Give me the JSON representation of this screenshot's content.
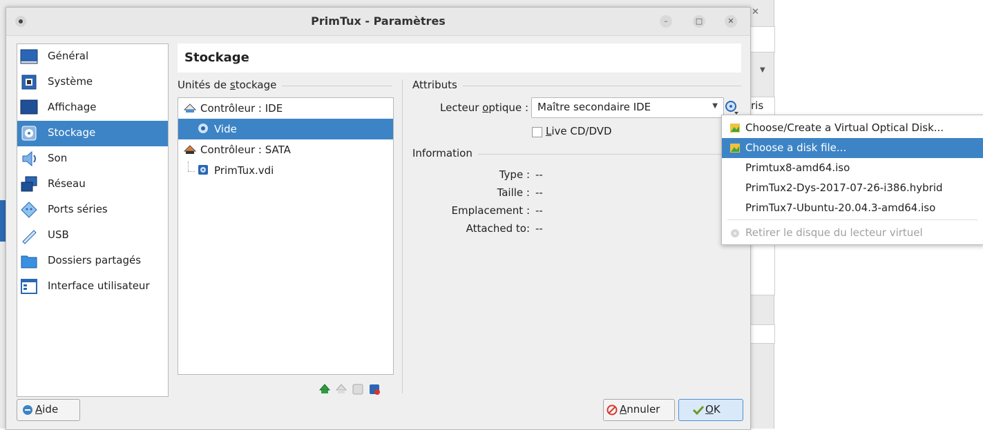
{
  "window": {
    "title": "PrimTux - Paramètres"
  },
  "sidebar": {
    "items": [
      {
        "label": "Général",
        "icon": "general-icon"
      },
      {
        "label": "Système",
        "icon": "system-icon"
      },
      {
        "label": "Affichage",
        "icon": "display-icon"
      },
      {
        "label": "Stockage",
        "icon": "storage-icon",
        "selected": true
      },
      {
        "label": "Son",
        "icon": "audio-icon"
      },
      {
        "label": "Réseau",
        "icon": "network-icon"
      },
      {
        "label": "Ports séries",
        "icon": "serial-ports-icon"
      },
      {
        "label": "USB",
        "icon": "usb-icon"
      },
      {
        "label": "Dossiers partagés",
        "icon": "shared-folders-icon"
      },
      {
        "label": "Interface utilisateur",
        "icon": "user-interface-icon"
      }
    ]
  },
  "page": {
    "title": "Stockage"
  },
  "storage": {
    "group_label_pre": "Unités de ",
    "group_label_mnemonic": "s",
    "group_label_post": "tockage",
    "tree": [
      {
        "label": "Contrôleur : IDE",
        "level": 0,
        "icon": "ide-controller-icon"
      },
      {
        "label": "Vide",
        "level": 1,
        "icon": "optical-disc-icon",
        "selected": true
      },
      {
        "label": "Contrôleur : SATA",
        "level": 0,
        "icon": "sata-controller-icon"
      },
      {
        "label": "PrimTux.vdi",
        "level": 1,
        "icon": "hard-disk-icon"
      }
    ]
  },
  "attributes": {
    "group_label": "Attributs",
    "optical_drive_label_pre": "Lecteur ",
    "optical_drive_label_mnemonic": "o",
    "optical_drive_label_post": "ptique :",
    "optical_drive_value": "Maître secondaire IDE",
    "live_cd_mnemonic": "L",
    "live_cd_label": "ive CD/DVD",
    "live_cd_checked": false
  },
  "information": {
    "group_label": "Information",
    "rows": [
      {
        "label": "Type :",
        "value": "--"
      },
      {
        "label": "Taille :",
        "value": "--"
      },
      {
        "label": "Emplacement :",
        "value": "--"
      },
      {
        "label": "Attached to:",
        "value": "--"
      }
    ]
  },
  "buttons": {
    "help_mnemonic": "A",
    "help_label": "ide",
    "cancel_mnemonic": "A",
    "cancel_label": "nnuler",
    "ok_mnemonic": "O",
    "ok_label": "K"
  },
  "background_fragment": "ris",
  "popup_menu": {
    "items": [
      {
        "label": "Choose/Create a Virtual Optical Disk...",
        "icon": "optical-disk-create-icon"
      },
      {
        "label": "Choose a disk file...",
        "icon": "disk-file-icon",
        "highlighted": true
      },
      {
        "label": "Primtux8-amd64.iso"
      },
      {
        "label": "PrimTux2-Dys-2017-07-26-i386.hybrid"
      },
      {
        "label": "PrimTux7-Ubuntu-20.04.3-amd64.iso"
      },
      {
        "label": "Retirer le disque du lecteur virtuel",
        "icon": "remove-disk-icon",
        "disabled": true
      }
    ]
  },
  "colors": {
    "accent": "#3d84c6",
    "dialog_bg": "#efefef"
  }
}
